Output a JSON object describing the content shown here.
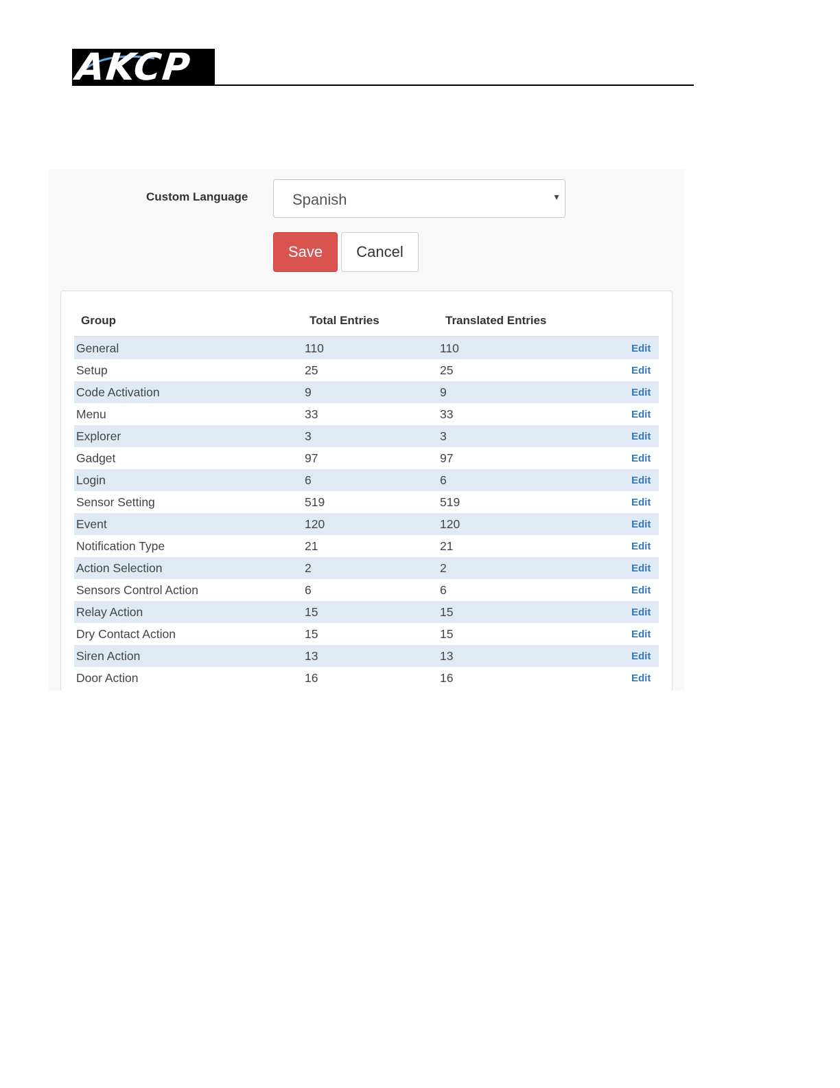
{
  "header": {
    "logo_text": "AKCP"
  },
  "form": {
    "language_label": "Custom Language",
    "language_value": "Spanish",
    "save_label": "Save",
    "cancel_label": "Cancel"
  },
  "table": {
    "columns": [
      "Group",
      "Total Entries",
      "Translated Entries"
    ],
    "edit_label": "Edit",
    "rows": [
      {
        "group": "General",
        "total": "110",
        "translated": "110"
      },
      {
        "group": "Setup",
        "total": "25",
        "translated": "25"
      },
      {
        "group": "Code Activation",
        "total": "9",
        "translated": "9"
      },
      {
        "group": "Menu",
        "total": "33",
        "translated": "33"
      },
      {
        "group": "Explorer",
        "total": "3",
        "translated": "3"
      },
      {
        "group": "Gadget",
        "total": "97",
        "translated": "97"
      },
      {
        "group": "Login",
        "total": "6",
        "translated": "6"
      },
      {
        "group": "Sensor Setting",
        "total": "519",
        "translated": "519"
      },
      {
        "group": "Event",
        "total": "120",
        "translated": "120"
      },
      {
        "group": "Notification Type",
        "total": "21",
        "translated": "21"
      },
      {
        "group": "Action Selection",
        "total": "2",
        "translated": "2"
      },
      {
        "group": "Sensors Control Action",
        "total": "6",
        "translated": "6"
      },
      {
        "group": "Relay Action",
        "total": "15",
        "translated": "15"
      },
      {
        "group": "Dry Contact Action",
        "total": "15",
        "translated": "15"
      },
      {
        "group": "Siren Action",
        "total": "13",
        "translated": "13"
      },
      {
        "group": "Door Action",
        "total": "16",
        "translated": "16"
      }
    ]
  },
  "colors": {
    "save_button": "#d9534f",
    "link": "#337ab7",
    "row_stripe": "#dfeaf5"
  }
}
